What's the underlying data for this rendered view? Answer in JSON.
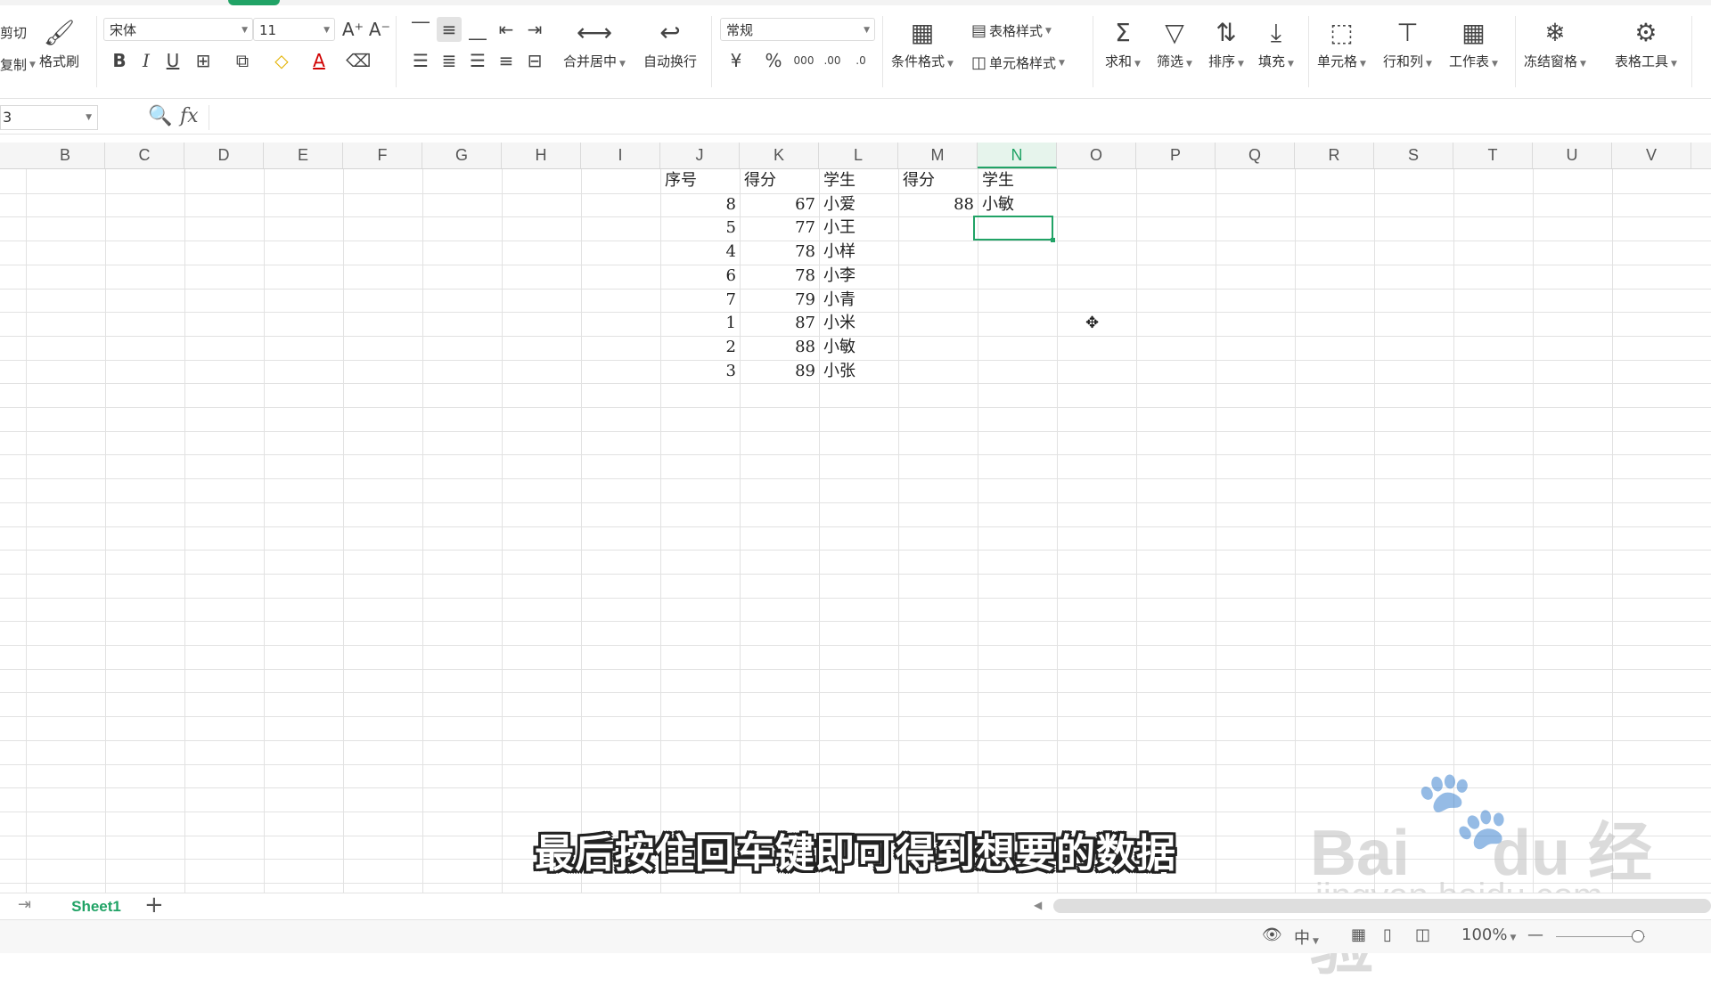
{
  "ribbon": {
    "clipboard": {
      "cut": "剪切",
      "copy": "复制",
      "format_painter": "格式刷"
    },
    "font": {
      "name": "宋体",
      "size": "11"
    },
    "merge_center": "合并居中",
    "wrap_text": "自动换行",
    "number_format": "常规",
    "conditional_format": "条件格式",
    "table_style": "表格样式",
    "cell_style": "单元格样式",
    "sum": "求和",
    "filter": "筛选",
    "sort": "排序",
    "fill": "填充",
    "cell": "单元格",
    "row_col": "行和列",
    "worksheet": "工作表",
    "freeze": "冻结窗格",
    "table_tools": "表格工具"
  },
  "formula_bar": {
    "name_box": "3",
    "fx": "fx",
    "formula": ""
  },
  "columns": [
    "B",
    "C",
    "D",
    "E",
    "F",
    "G",
    "H",
    "I",
    "J",
    "K",
    "L",
    "M",
    "N",
    "O",
    "P",
    "Q",
    "R",
    "S",
    "T",
    "U",
    "V"
  ],
  "active_column": "N",
  "sheet": {
    "J": [
      "序号",
      "8",
      "5",
      "4",
      "6",
      "7",
      "1",
      "2",
      "3"
    ],
    "K": [
      "得分",
      "67",
      "77",
      "78",
      "78",
      "79",
      "87",
      "88",
      "89"
    ],
    "L": [
      "学生",
      "小爱",
      "小王",
      "小样",
      "小李",
      "小青",
      "小米",
      "小敏",
      "小张"
    ],
    "M": [
      "得分",
      "88"
    ],
    "N": [
      "学生",
      "小敏"
    ]
  },
  "caption": "最后按住回车键即可得到想要的数据",
  "watermark": {
    "logo": "Bai",
    "logo2": "du 经验",
    "url": "jingyan.baidu.com"
  },
  "tabs": {
    "sheet1": "Sheet1",
    "add": "+"
  },
  "status": {
    "zoom": "100%",
    "ime": "中"
  },
  "colors": {
    "accent": "#21a366"
  }
}
